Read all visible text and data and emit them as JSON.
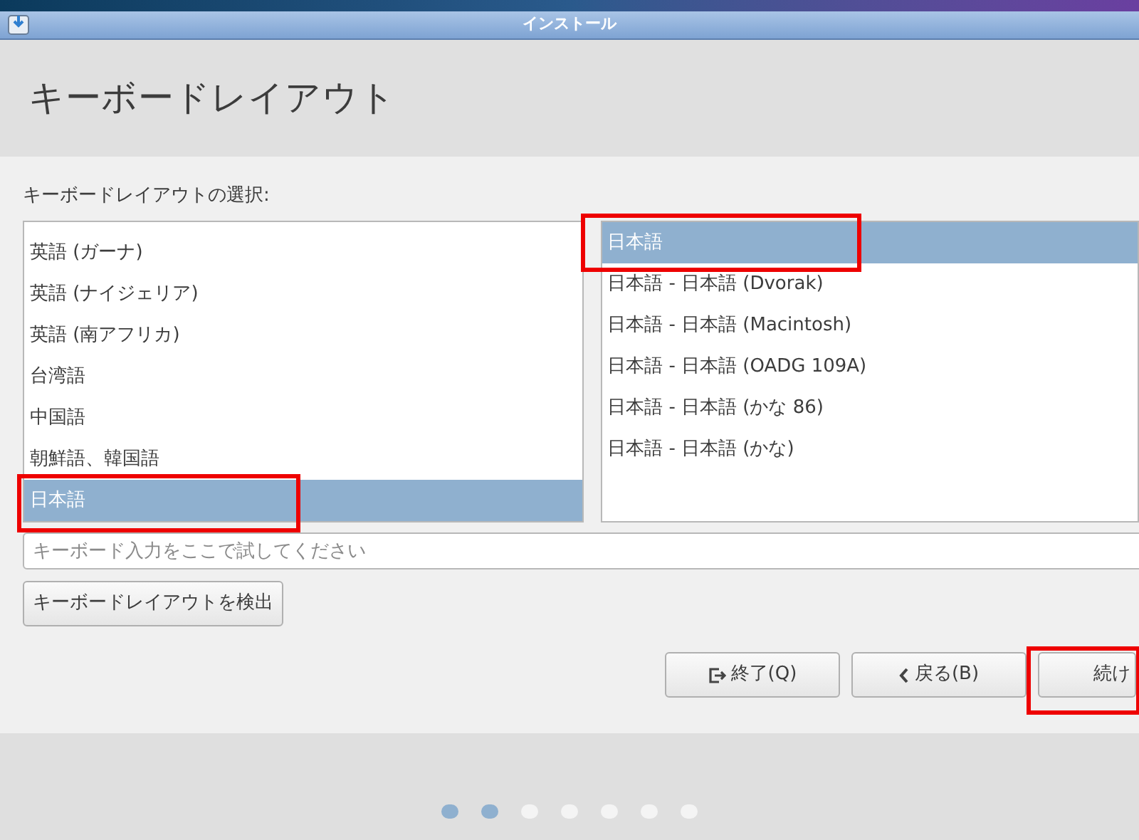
{
  "window": {
    "title": "インストール"
  },
  "header": {
    "title": "キーボードレイアウト"
  },
  "layout_label": "キーボードレイアウトの選択:",
  "languages": [
    {
      "label": "英語 (ガーナ)",
      "selected": false,
      "highlighted": false
    },
    {
      "label": "英語 (ナイジェリア)",
      "selected": false,
      "highlighted": false
    },
    {
      "label": "英語 (南アフリカ)",
      "selected": false,
      "highlighted": false
    },
    {
      "label": "台湾語",
      "selected": false,
      "highlighted": false
    },
    {
      "label": "中国語",
      "selected": false,
      "highlighted": false
    },
    {
      "label": "朝鮮語、韓国語",
      "selected": false,
      "highlighted": false
    },
    {
      "label": "日本語",
      "selected": true,
      "highlighted": true
    }
  ],
  "variants": [
    {
      "label": "日本語",
      "selected": true,
      "highlighted": true
    },
    {
      "label": "日本語 - 日本語 (Dvorak)",
      "selected": false,
      "highlighted": false
    },
    {
      "label": "日本語 - 日本語 (Macintosh)",
      "selected": false,
      "highlighted": false
    },
    {
      "label": "日本語 - 日本語 (OADG 109A)",
      "selected": false,
      "highlighted": false
    },
    {
      "label": "日本語 - 日本語 (かな 86)",
      "selected": false,
      "highlighted": false
    },
    {
      "label": "日本語 - 日本語 (かな)",
      "selected": false,
      "highlighted": false
    }
  ],
  "test_field": {
    "placeholder": "キーボード入力をここで試してください"
  },
  "detect_button": "キーボードレイアウトを検出",
  "buttons": [
    {
      "kind": "quit",
      "label": "終了(Q)",
      "highlighted": false
    },
    {
      "kind": "back",
      "label": "戻る(B)",
      "highlighted": false
    },
    {
      "kind": "continue",
      "label": "続け",
      "highlighted": true
    }
  ],
  "steps": [
    {
      "done": true
    },
    {
      "done": true
    },
    {
      "done": false
    },
    {
      "done": false
    },
    {
      "done": false
    },
    {
      "done": false
    },
    {
      "done": false
    }
  ]
}
